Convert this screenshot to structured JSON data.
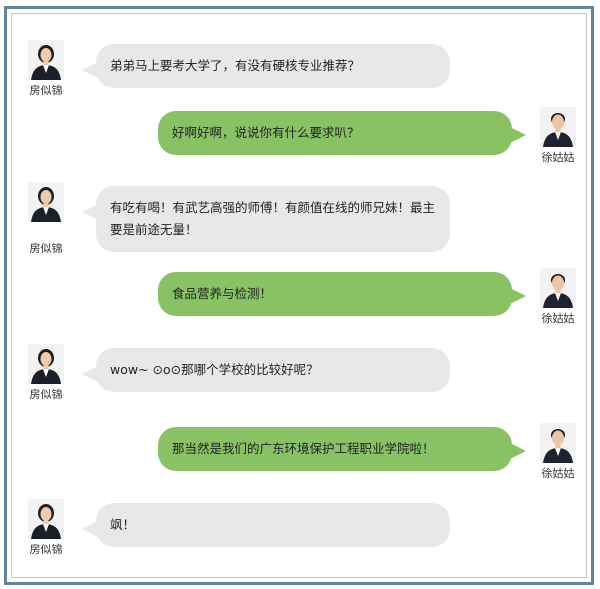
{
  "colors": {
    "frame": "#5f84a6",
    "left_bubble": "#e8e8e8",
    "right_bubble": "#89c265"
  },
  "users": {
    "left": {
      "name": "房似锦",
      "avatar": "woman-avatar-icon"
    },
    "right": {
      "name": "徐姑姑",
      "avatar": "man-avatar-icon"
    }
  },
  "messages": [
    {
      "side": "left",
      "text": "弟弟马上要考大学了，有没有硬核专业推荐？"
    },
    {
      "side": "right",
      "text": "好啊好啊，说说你有什么要求叭？"
    },
    {
      "side": "left",
      "text": "有吃有喝！有武艺高强的师傅！有颜值在线的师兄妹！最主要是前途无量！"
    },
    {
      "side": "right",
      "text": "食品营养与检测！"
    },
    {
      "side": "left",
      "text": "wow~ ⊙o⊙那哪个学校的比较好呢？"
    },
    {
      "side": "right",
      "text": "那当然是我们的广东环境保护工程职业学院啦！"
    },
    {
      "side": "left",
      "text": "飒！"
    }
  ]
}
